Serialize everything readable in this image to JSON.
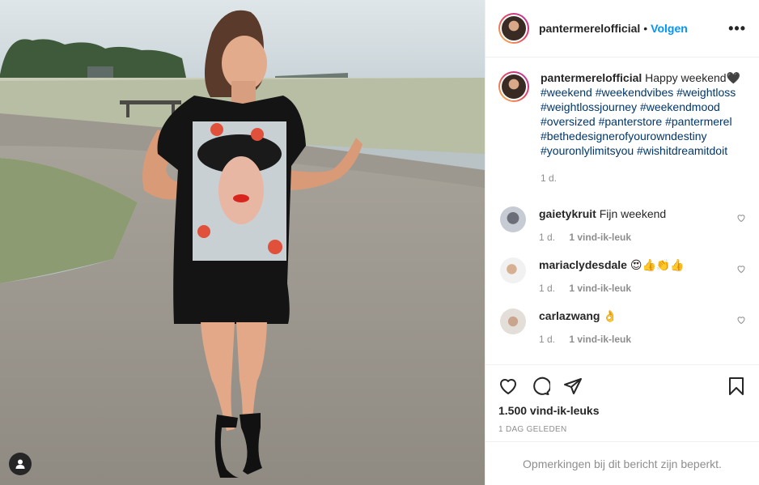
{
  "post": {
    "username": "pantermerelofficial",
    "separator": "•",
    "follow_label": "Volgen",
    "more_label": "•••"
  },
  "caption": {
    "username": "pantermerelofficial",
    "text": "Happy weekend🖤",
    "hashtags": "#weekend #weekendvibes #weightloss #weightlossjourney #weekendmood #oversized #panterstore #pantermerel #bethedesignerofyourowndestiny #youronlylimitsyou #wishitdreamitdoit",
    "time": "1 d."
  },
  "comments": [
    {
      "username": "gaietykruit",
      "text": "Fijn weekend",
      "time": "1 d.",
      "likes": ""
    },
    {
      "username": "mariaclydesdale",
      "text": "😍👍👏👍",
      "time": "1 d.",
      "likes": "1 vind-ik-leuk"
    },
    {
      "username": "carlazwang",
      "text": "👌",
      "time": "1 d.",
      "likes": "1 vind-ik-leuk"
    }
  ],
  "comment0_likes": "1 vind-ik-leuk",
  "likes_count": "1.500 vind-ik-leuks",
  "posted_ago": "1 DAG GELEDEN",
  "comments_restricted": "Opmerkingen bij dit bericht zijn beperkt.",
  "colors": {
    "link_blue": "#0095f6",
    "hashtag_blue": "#00376b",
    "muted_gray": "#8e8e8e",
    "text_dark": "#262626"
  },
  "icons": [
    "user-tag-icon",
    "more-options-icon",
    "heart-icon",
    "comment-icon",
    "share-icon",
    "bookmark-icon"
  ]
}
